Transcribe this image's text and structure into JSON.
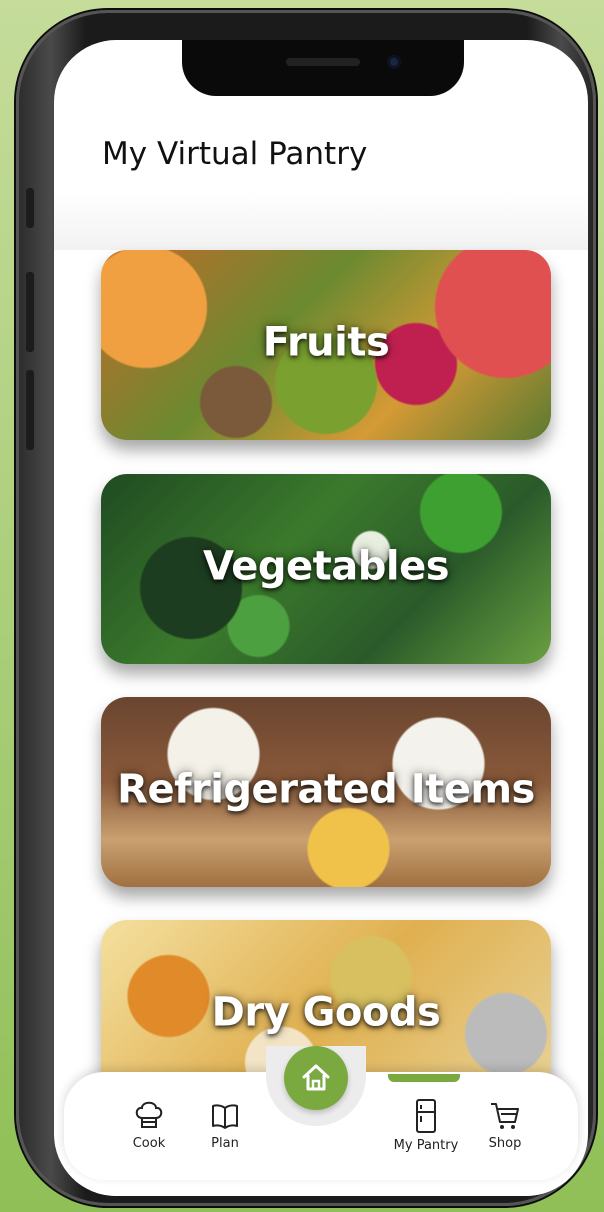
{
  "app": {
    "title": "My Virtual Pantry"
  },
  "categories": [
    {
      "label": "Fruits"
    },
    {
      "label": "Vegetables"
    },
    {
      "label": "Refrigerated Items"
    },
    {
      "label": "Dry Goods"
    }
  ],
  "bottom_nav": {
    "items": [
      {
        "label": "Cook",
        "icon": "chef-hat-icon"
      },
      {
        "label": "Plan",
        "icon": "open-book-icon"
      },
      {
        "label": "",
        "icon": "home-icon"
      },
      {
        "label": "My Pantry",
        "icon": "fridge-icon"
      },
      {
        "label": "Shop",
        "icon": "shopping-cart-icon"
      }
    ],
    "active": "My Pantry"
  },
  "colors": {
    "accent": "#7aa940",
    "background": "#b4d184"
  }
}
